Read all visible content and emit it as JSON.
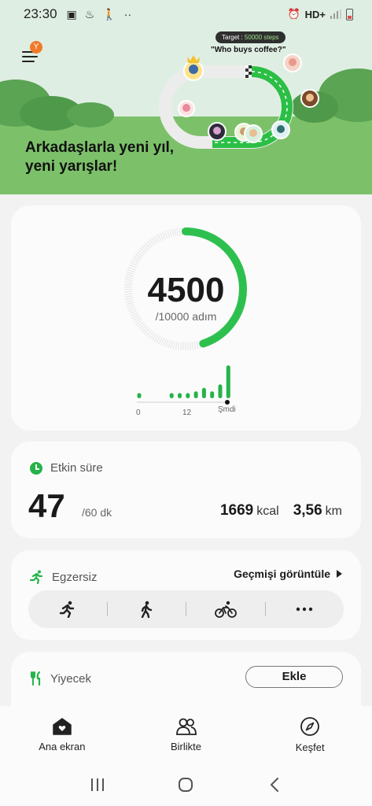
{
  "status_bar": {
    "time": "23:30",
    "network": "HD+"
  },
  "banner": {
    "menu_badge": "Y",
    "target_label": "Target :",
    "target_value": "50000 steps",
    "quote": "\"Who buys coffee?\"",
    "title_line1": "Arkadaşlarla yeni yıl,",
    "title_line2": "yeni yarışlar!"
  },
  "steps": {
    "count": "4500",
    "goal": "/10000 adım",
    "progress": 0.45,
    "axis": {
      "start": "0",
      "mid": "12",
      "now": "Şmdi"
    },
    "hourly_bars": [
      0.15,
      0,
      0,
      0,
      0.15,
      0.15,
      0.15,
      0.2,
      0.3,
      0.2,
      0.4,
      0.95
    ]
  },
  "active_time": {
    "label": "Etkin süre",
    "minutes": "47",
    "goal": "/60 dk",
    "kcal_value": "1669",
    "kcal_unit": "kcal",
    "distance_value": "3,56",
    "distance_unit": "km"
  },
  "exercise": {
    "label": "Egzersiz",
    "history_link": "Geçmişi görüntüle",
    "buttons": [
      "running-icon",
      "walking-icon",
      "cycling-icon",
      "more-icon"
    ]
  },
  "food": {
    "label": "Yiyecek",
    "add_button": "Ekle"
  },
  "nav": {
    "home": "Ana ekran",
    "together": "Birlikte",
    "discover": "Keşfet"
  },
  "colors": {
    "accent": "#26b34a",
    "banner_bg": "#dfeee3",
    "ground": "#7cc16a",
    "badge": "#f07a2a"
  }
}
